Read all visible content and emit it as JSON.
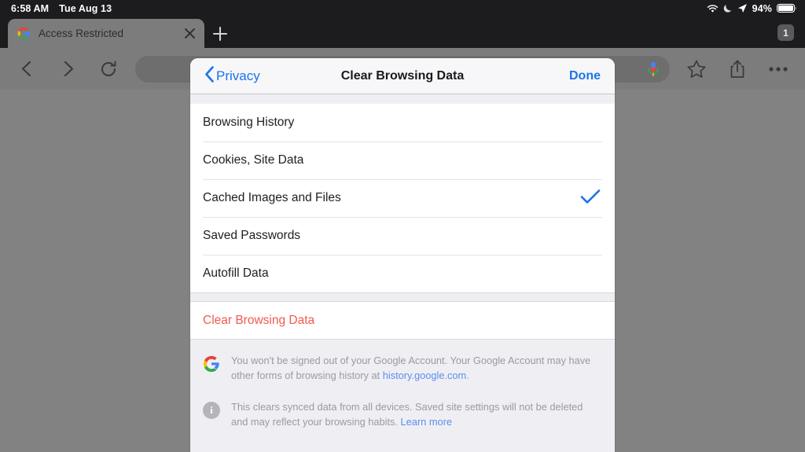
{
  "statusbar": {
    "time": "6:58 AM",
    "date": "Tue Aug 13",
    "battery_percent": "94%",
    "icons": [
      "wifi-icon",
      "moon-icon",
      "location-arrow-icon",
      "battery-icon"
    ]
  },
  "tabstrip": {
    "tab": {
      "title": "Access Restricted",
      "favicon": "google-favicon",
      "close": "×"
    },
    "new_tab": "+",
    "tab_count": "1"
  },
  "toolbar": {
    "back": "back-icon",
    "forward": "forward-icon",
    "reload": "reload-icon",
    "omnibox_value": "",
    "omnibox_placeholder": "",
    "mic": "microphone-icon",
    "bookmark": "star-icon",
    "share": "share-icon",
    "more": "more-icon"
  },
  "modal": {
    "header": {
      "back_label": "Privacy",
      "title": "Clear Browsing Data",
      "done_label": "Done"
    },
    "options": [
      {
        "label": "Browsing History",
        "checked": false
      },
      {
        "label": "Cookies, Site Data",
        "checked": false
      },
      {
        "label": "Cached Images and Files",
        "checked": true
      },
      {
        "label": "Saved Passwords",
        "checked": false
      },
      {
        "label": "Autofill Data",
        "checked": false
      }
    ],
    "action_label": "Clear Browsing Data",
    "footer": [
      {
        "icon": "google-g-icon",
        "text_before": "You won't be signed out of your Google Account. Your Google Account may have other forms of browsing history at ",
        "link": "history.google.com",
        "text_after": "."
      },
      {
        "icon": "info-icon",
        "text_before": "This clears synced data from all devices. Saved site settings will not be deleted and may reflect your browsing habits. ",
        "link": "Learn more",
        "text_after": ""
      }
    ]
  },
  "colors": {
    "accent_blue": "#1a73e8",
    "destructive_red": "#ef5b4c",
    "link_blue": "#5b8def",
    "statusbar_bg": "#1c1c1e",
    "dim_overlay": "#828282"
  }
}
